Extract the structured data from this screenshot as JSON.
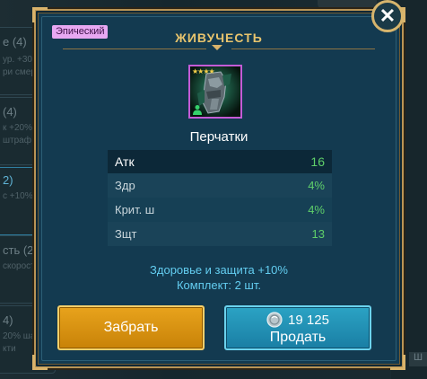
{
  "background": {
    "cards": [
      {
        "title": "e (4)",
        "sub": "ур. +30%",
        "sub2": "ри смер"
      },
      {
        "title": "(4)",
        "sub": "к +20%",
        "sub2": "штраф с"
      },
      {
        "title": "2)",
        "sub": "с +10%",
        "sub2": ""
      },
      {
        "title": "сть (2)",
        "sub": "скорост",
        "sub2": ""
      },
      {
        "title": "4)",
        "sub": "20% шан",
        "sub2": "кти"
      }
    ],
    "corner_text": "Ш"
  },
  "dialog": {
    "rarity": "Эпический",
    "set_name": "ЖИВУЧЕСТЬ",
    "item": {
      "name": "Перчатки",
      "stars": "★★★★",
      "icon": "gauntlet-icon"
    },
    "stats": [
      {
        "name": "Атк",
        "value": "16"
      },
      {
        "name": "Здр",
        "value": "4%"
      },
      {
        "name": "Крит. ш",
        "value": "4%"
      },
      {
        "name": "Зщт",
        "value": "13"
      }
    ],
    "set_bonus": {
      "effect": "Здоровье и защита +10%",
      "requirement": "Комплект: 2 шт."
    },
    "buttons": {
      "take_label": "Забрать",
      "sell_price": "19 125",
      "sell_label": "Продать"
    },
    "close_icon": "close-icon"
  },
  "colors": {
    "rarity_epic": "#e7a8f2",
    "gold_accent": "#e8c46d",
    "stat_value": "#5fcf6a",
    "set_bonus_text": "#63cdf0",
    "take_button": "#e8a31c",
    "sell_button": "#2ba3c4"
  }
}
